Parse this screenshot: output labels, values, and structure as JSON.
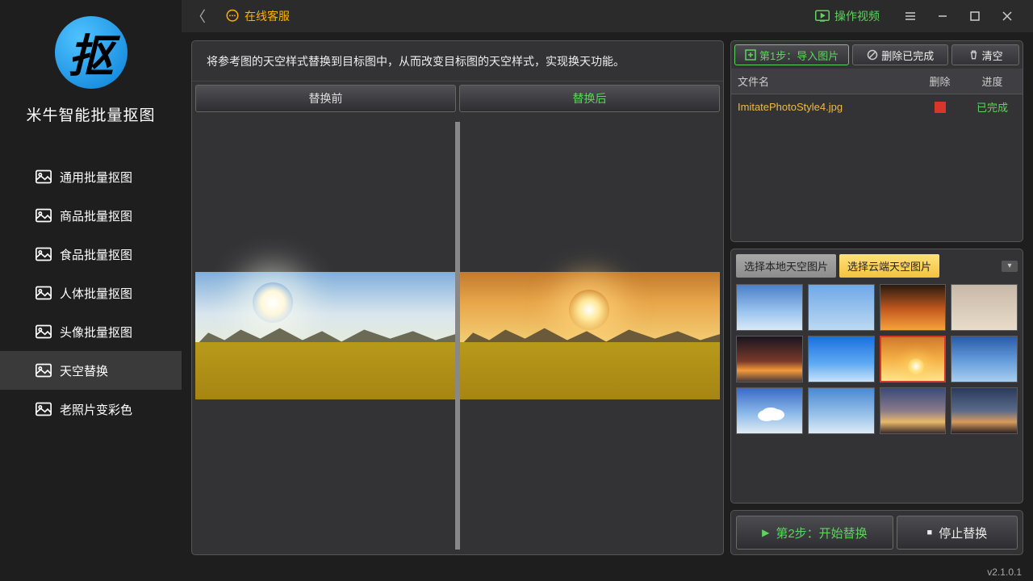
{
  "titlebar": {
    "support": "在线客服",
    "opvideo": "操作视频"
  },
  "app": {
    "name": "米牛智能批量抠图",
    "logo_char": "抠"
  },
  "nav": [
    {
      "label": "通用批量抠图"
    },
    {
      "label": "商品批量抠图"
    },
    {
      "label": "食品批量抠图"
    },
    {
      "label": "人体批量抠图"
    },
    {
      "label": "头像批量抠图"
    },
    {
      "label": "天空替换",
      "active": true
    },
    {
      "label": "老照片变彩色"
    }
  ],
  "main": {
    "description": "将参考图的天空样式替换到目标图中，从而改变目标图的天空样式，实现换天功能。",
    "tab_before": "替换前",
    "tab_after": "替换后"
  },
  "actions": {
    "import": "第1步：导入图片",
    "delete_done": "删除已完成",
    "clear": "清空"
  },
  "filetable": {
    "col_name": "文件名",
    "col_delete": "删除",
    "col_progress": "进度",
    "rows": [
      {
        "name": "ImitatePhotoStyle4.jpg",
        "progress": "已完成"
      }
    ]
  },
  "skypanel": {
    "tab_local": "选择本地天空图片",
    "tab_cloud": "选择云端天空图片"
  },
  "footer": {
    "start": "第2步：开始替换",
    "stop": "停止替换"
  },
  "version": "v2.1.0.1"
}
